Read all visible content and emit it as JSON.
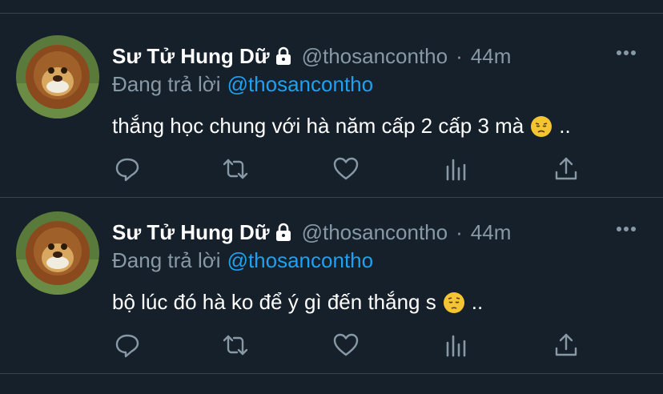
{
  "tweets": [
    {
      "author": {
        "name": "Sư Tử Hung Dữ",
        "handle": "@thosancontho",
        "time": "44m"
      },
      "separator": "·",
      "reply": {
        "label": "Đang trả lời",
        "mention": "@thosancontho"
      },
      "text_before_emoji": "thắng học chung với hà năm cấp 2 cấp 3 mà",
      "emoji": "disappointed-face",
      "text_after_emoji": ".."
    },
    {
      "author": {
        "name": "Sư Tử Hung Dữ",
        "handle": "@thosancontho",
        "time": "44m"
      },
      "separator": "·",
      "reply": {
        "label": "Đang trả lời",
        "mention": "@thosancontho"
      },
      "text_before_emoji": "bộ lúc đó hà ko để ý gì đến thắng s",
      "emoji": "pensive-face",
      "text_after_emoji": ".."
    }
  ],
  "colors": {
    "background": "#15202b",
    "divider": "#38444d",
    "secondary_text": "#8899a6",
    "link": "#1da1f2",
    "emoji_yellow": "#f5c431"
  },
  "icons": [
    "lock-icon",
    "more-icon",
    "reply-icon",
    "retweet-icon",
    "like-icon",
    "analytics-icon",
    "share-icon"
  ]
}
